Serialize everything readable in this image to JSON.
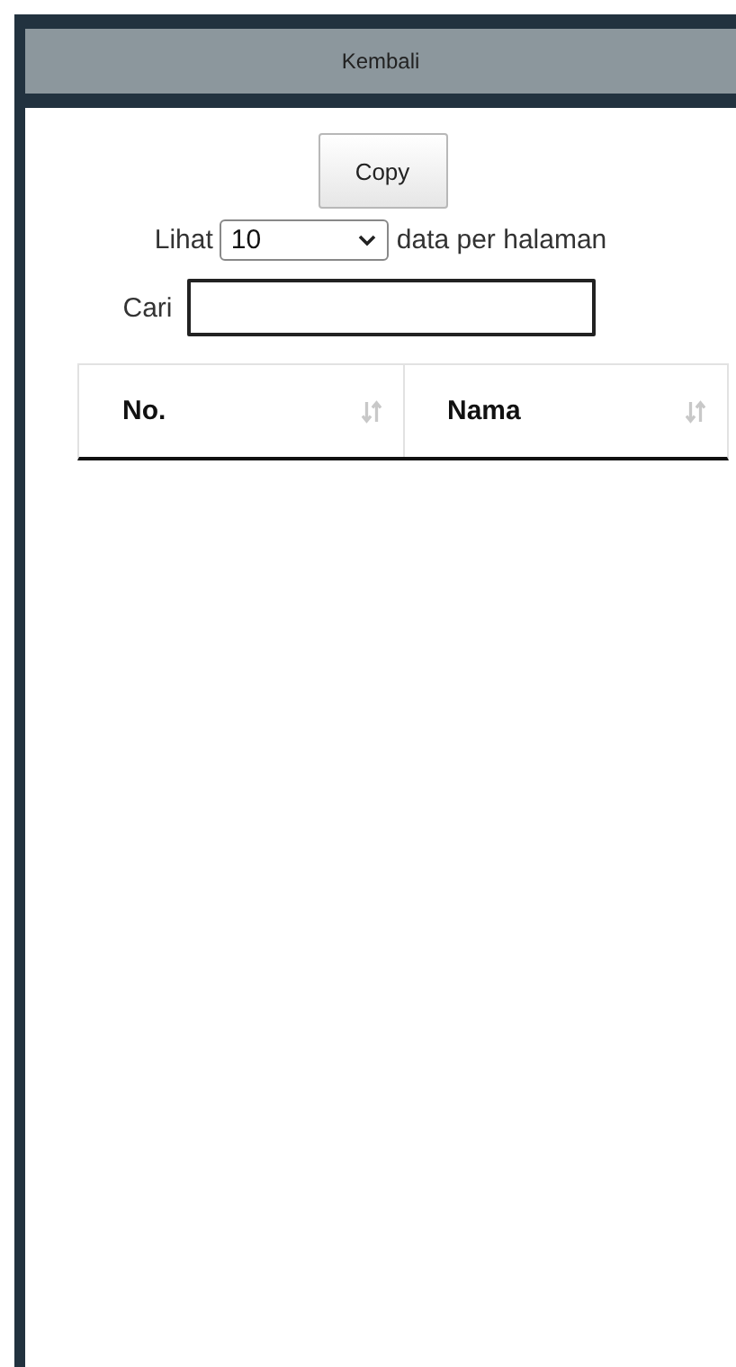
{
  "header": {
    "back_label": "Kembali"
  },
  "toolbar": {
    "copy_button": "Copy"
  },
  "length_menu": {
    "prefix": "Lihat",
    "value": "10",
    "suffix": "data per halaman"
  },
  "search": {
    "label": "Cari"
  },
  "table": {
    "columns": [
      {
        "label": "No.",
        "sortable": true
      },
      {
        "label": "Nama",
        "sortable": true
      }
    ]
  }
}
